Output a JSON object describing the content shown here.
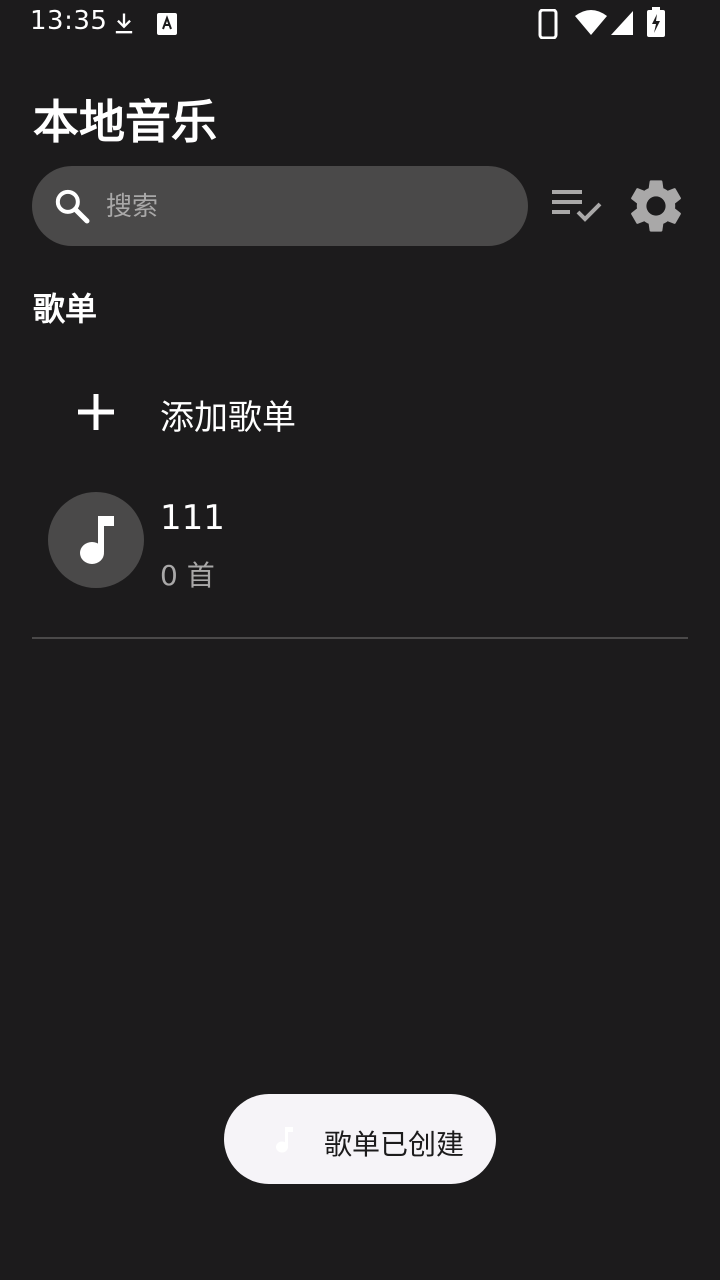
{
  "status_bar": {
    "time": "13:35",
    "icons": [
      "download-icon",
      "text-a-icon",
      "phone-icon",
      "wifi-icon",
      "signal-icon",
      "battery-charging-icon"
    ]
  },
  "header": {
    "title": "本地音乐"
  },
  "search": {
    "placeholder": "搜索",
    "value": ""
  },
  "toolbar": {
    "icons": [
      "playlist-check-icon",
      "gear-icon"
    ]
  },
  "playlists_section": {
    "title": "歌单",
    "add_label": "添加歌单",
    "items": [
      {
        "name": "111",
        "count": "0 首",
        "icon": "music-note-icon"
      }
    ]
  },
  "toast": {
    "text": "歌单已创建",
    "icon": "music-note-icon"
  },
  "colors": {
    "background": "#1c1b1c",
    "surface": "#4a4949",
    "text_primary": "#ffffff",
    "text_secondary": "#a9a8a8",
    "toast_background": "#f6f4f8"
  }
}
